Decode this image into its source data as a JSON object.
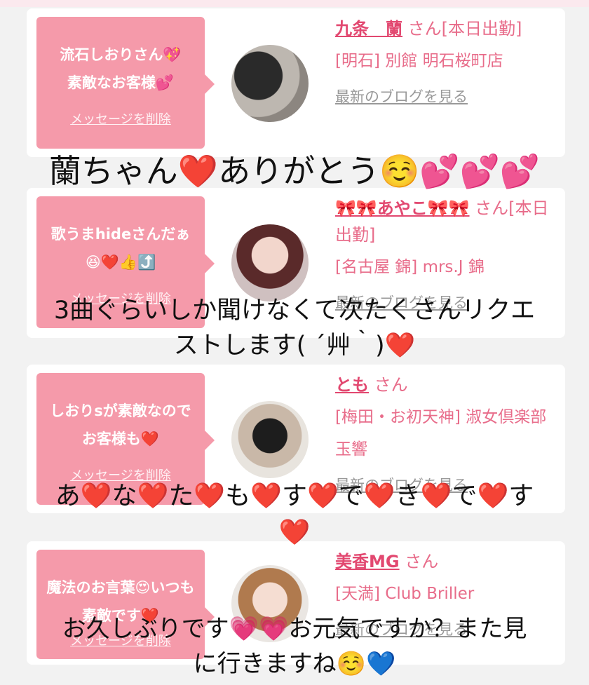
{
  "cards": [
    {
      "message": "流石しおりさん💖\n素敵なお客様💕",
      "delete_label": "メッセージを削除",
      "name": "九条　蘭",
      "san_status": "さん[本日出勤]",
      "shop": "[明石] 別館 明石桜町店",
      "blog_label": "最新のブログを見る"
    },
    {
      "message": "歌うまhideさんだぁ😆❤️👍⤴️",
      "delete_label": "メッセージを削除",
      "name": "🎀🎀あやこ🎀🎀",
      "san_status": "さん[本日出勤]",
      "shop": "[名古屋 錦] mrs.J 錦",
      "blog_label": "最新のブログを見る"
    },
    {
      "message": "しおりsが素敵なのでお客様も❤️",
      "delete_label": "メッセージを削除",
      "name": "とも",
      "san_status": "さん",
      "shop": "[梅田・お初天神] 淑女倶楽部 玉響",
      "blog_label": "最新のブログを見る"
    },
    {
      "message": "魔法のお言葉😍いつも素敵です❤️",
      "delete_label": "メッセージを削除",
      "name": "美香MG",
      "san_status": "さん",
      "shop": "[天満] Club Briller",
      "blog_label": "最新のブログを見る"
    }
  ],
  "overlays": {
    "caption1": "蘭ちゃん❤️ありがとう☺️💕💕💕",
    "caption2_line1": "3曲ぐらいしか聞けなくて次たくさんリクエ",
    "caption2_line2": "ストします( ´艸｀)❤️",
    "caption3_line1": "あ❤️な❤️た❤️も❤️す❤️で❤️き❤️で❤️す",
    "caption3_line2": "❤️",
    "caption4_line1": "お久しぶりです💗💗お元気ですか？また見",
    "caption4_line2": "に行きますね☺️💙"
  },
  "colors": {
    "bubble": "#f59aaa",
    "name_pink": "#e24870",
    "link_gray": "#999999"
  }
}
